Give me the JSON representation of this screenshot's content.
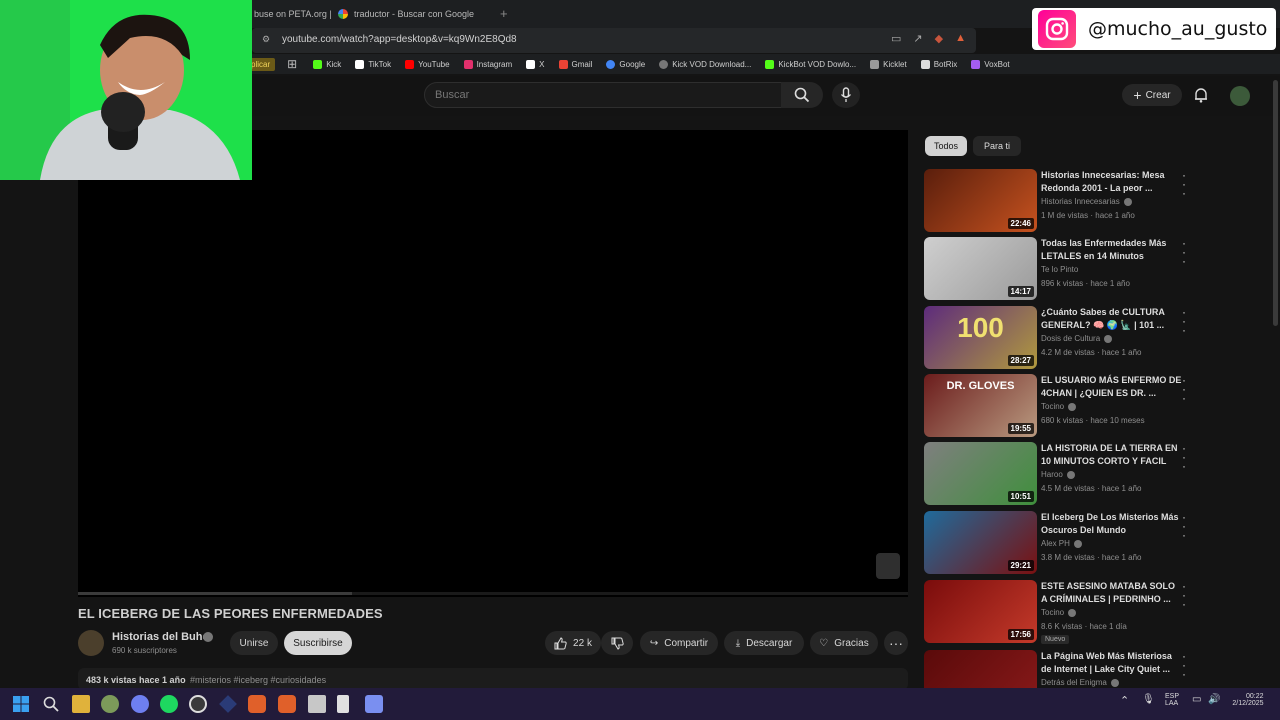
{
  "browser": {
    "tabs": [
      {
        "label": "buse on PETA.org |"
      },
      {
        "label": "traductor - Buscar con Google"
      }
    ],
    "new_tab": "+",
    "url": "youtube.com/watch?app=desktop&v=kq9Wn2E8Qd8",
    "bookmarks": [
      {
        "label": "plicar",
        "color": "#f2d55a"
      },
      {
        "label": "Kick",
        "color": "#53fc18"
      },
      {
        "label": "TikTok",
        "color": "#ffffff"
      },
      {
        "label": "YouTube",
        "color": "#ff0000"
      },
      {
        "label": "Instagram",
        "color": "#e1306c"
      },
      {
        "label": "X",
        "color": "#ffffff"
      },
      {
        "label": "Gmail",
        "color": "#ea4335"
      },
      {
        "label": "Google",
        "color": "#4285f4"
      },
      {
        "label": "Kick VOD Download...",
        "color": "#777777"
      },
      {
        "label": "KickBot VOD Dowlo...",
        "color": "#53fc18"
      },
      {
        "label": "Kicklet",
        "color": "#999999"
      },
      {
        "label": "BotRix",
        "color": "#dddddd"
      },
      {
        "label": "VoxBot",
        "color": "#a45df0"
      }
    ]
  },
  "header": {
    "search_placeholder": "Buscar",
    "create_label": "Crear"
  },
  "video": {
    "title": "EL ICEBERG DE LAS PEORES ENFERMEDADES",
    "channel": "Historias del Buho",
    "subscribers": "690 k suscriptores",
    "join_label": "Unirse",
    "subscribe_label": "Suscribirse",
    "likes": "22 k",
    "share_label": "Compartir",
    "download_label": "Descargar",
    "thanks_label": "Gracias",
    "views_date": "483 k vistas  hace 1 año",
    "tags": "#misterios #iceberg #curiosidades",
    "progress_fraction": 0.33
  },
  "sidebar": {
    "chips": [
      "Todos",
      "Para ti"
    ],
    "recs": [
      {
        "title": "Historias Innecesarias: Mesa Redonda 2001 - La peor ...",
        "channel": "Historias Innecesarias",
        "verified": true,
        "meta": "1 M de vistas · hace 1 año",
        "duration": "22:46",
        "colors": [
          "#5a1e0c",
          "#c6521f"
        ]
      },
      {
        "title": "Todas las Enfermedades Más LETALES en 14 Minutos",
        "channel": "Te lo Pinto",
        "verified": false,
        "meta": "896 k vistas · hace 1 año",
        "duration": "14:17",
        "colors": [
          "#cfcfcf",
          "#9a9a9a"
        ]
      },
      {
        "title": "¿Cuánto Sabes de CULTURA GENERAL? 🧠 🌍 🗽 | 101 ...",
        "channel": "Dosis de Cultura",
        "verified": true,
        "meta": "4.2 M de vistas · hace 1 año",
        "duration": "28:27",
        "colors": [
          "#5d2b7c",
          "#b19a3e"
        ],
        "big": "100"
      },
      {
        "title": "EL USUARIO MÁS ENFERMO DE 4CHAN | ¿QUIEN ES DR. ...",
        "channel": "Tocino",
        "verified": true,
        "meta": "680 k vistas · hace 10 meses",
        "duration": "19:55",
        "colors": [
          "#6b1c1c",
          "#b99a80"
        ],
        "big": "DR. GLOVES"
      },
      {
        "title": "LA HISTORIA DE LA TIERRA EN 10 MINUTOS CORTO Y FACIL",
        "channel": "Haroo",
        "verified": true,
        "meta": "4.5 M de vistas · hace 1 año",
        "duration": "10:51",
        "colors": [
          "#7f7f7f",
          "#3f8f3c"
        ]
      },
      {
        "title": "El Iceberg De Los Misterios Más Oscuros Del Mundo",
        "channel": "Alex PH",
        "verified": true,
        "meta": "3.8 M de vistas · hace 1 año",
        "duration": "29:21",
        "colors": [
          "#1f6b9c",
          "#7a1010"
        ]
      },
      {
        "title": "ESTE ASESINO MATABA SOLO A CRÍMINALES | PEDRINHO ...",
        "channel": "Tocino",
        "verified": true,
        "meta": "8.6 K vistas · hace 1 día",
        "badge": "Nuevo",
        "duration": "17:56",
        "colors": [
          "#7a0c0c",
          "#c43a2a"
        ]
      },
      {
        "title": "La Página Web Más Misteriosa de Internet | Lake City Quiet ...",
        "channel": "Detrás del Enigma",
        "verified": true,
        "meta": "",
        "duration": "",
        "colors": [
          "#5a0a0a",
          "#8a1a1a"
        ]
      }
    ]
  },
  "overlay": {
    "instagram_handle": "@mucho_au_gusto"
  },
  "taskbar": {
    "lang_top": "ESP",
    "lang_bottom": "LAA",
    "time": "00:22",
    "date": "2/12/2025"
  },
  "colors": {
    "youtube_bg": "#141414",
    "taskbar": "#221b3a",
    "webcam_green": "#1ee04a",
    "subscribe_bg": "#d6d6d6"
  }
}
